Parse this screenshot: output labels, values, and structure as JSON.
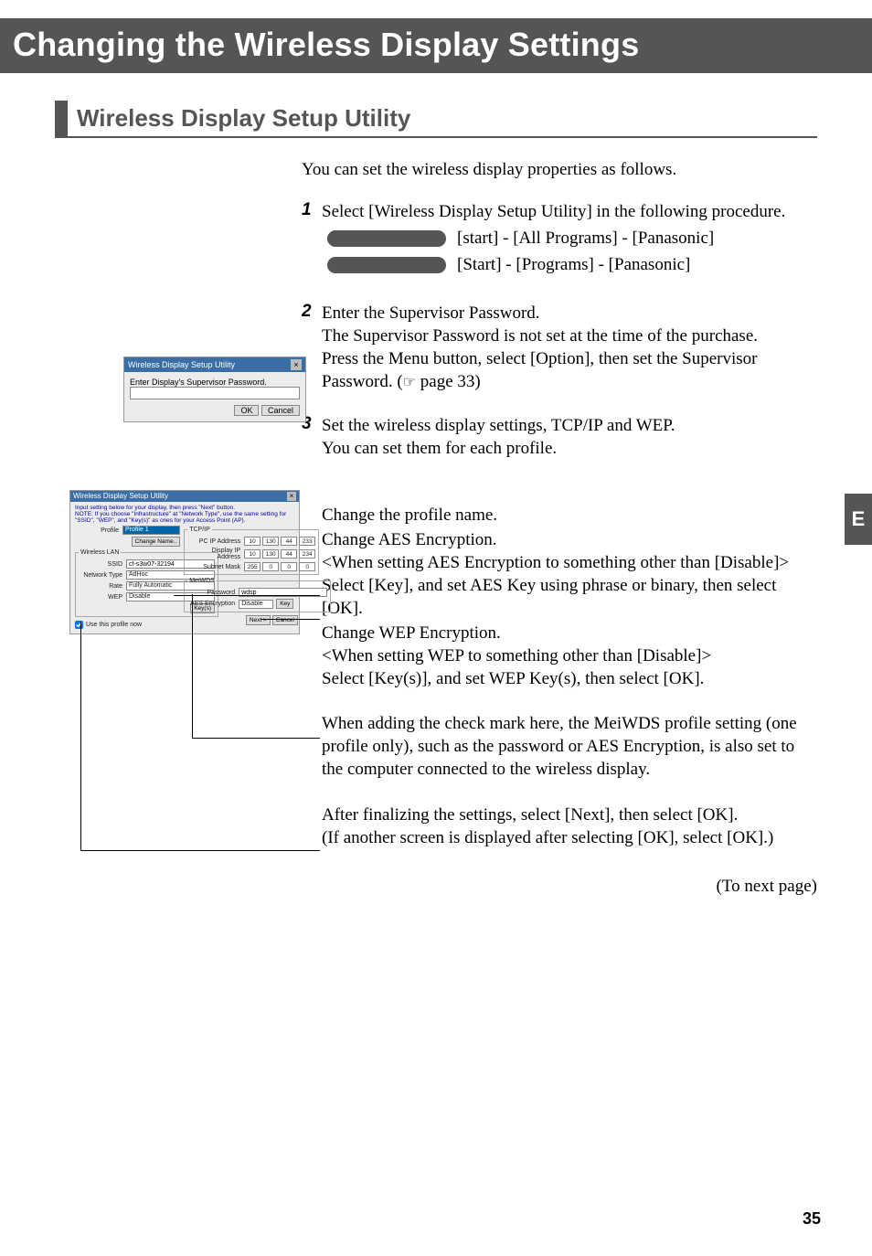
{
  "page": {
    "title": "Changing the Wireless Display Settings",
    "section_heading": "Wireless Display Setup Utility",
    "intro": "You can set the wireless display properties as follows.",
    "to_next": "(To next page)",
    "number": "35",
    "side_tab": "E"
  },
  "steps": {
    "s1": {
      "num": "1",
      "text": "Select [Wireless Display Setup Utility] in the following procedure.",
      "os1": "[start] - [All Programs] - [Panasonic]",
      "os2": "[Start] - [Programs] - [Panasonic]"
    },
    "s2": {
      "num": "2",
      "line1": "Enter the Supervisor Password.",
      "line2": "The Supervisor Password is not set at the time of the purchase.",
      "line3a": "Press the Menu button, select [Option], then set the Supervisor Password.  (",
      "line3c": " page 33)"
    },
    "s3": {
      "num": "3",
      "line1": "Set the wireless display settings, TCP/IP and WEP.",
      "line2": "You can set them for each profile."
    }
  },
  "callouts": {
    "c1": "Change the profile name.",
    "c2a": "Change AES Encryption.",
    "c2b": "<When setting AES Encryption to something other than [Disable]>",
    "c2c": "Select [Key], and set AES Key using phrase or binary, then select [OK].",
    "c3a": "Change WEP Encryption.",
    "c3b": "<When setting WEP to something other than [Disable]>",
    "c3c": "Select [Key(s)], and set WEP Key(s), then select [OK].",
    "c4": "When adding the check mark here, the MeiWDS profile setting (one profile only), such as the password or AES Encryption, is also set to the computer connected to the wireless display.",
    "c5": "After finalizing the settings, select [Next], then select [OK].",
    "c6": "(If another screen is displayed after selecting [OK], select [OK].)"
  },
  "dialog1": {
    "title": "Wireless Display Setup Utility",
    "prompt": "Enter Display's Supervisor Password.",
    "ok": "OK",
    "cancel": "Cancel"
  },
  "dialog2": {
    "title": "Wireless Display Setup Utility",
    "note1": "Input setting below for your display, then press \"Next\" button.",
    "note2": "NOTE: If you choose \"Infrastructure\" at \"Network Type\", use the same setting for \"SSID\", \"WEP\", and \"Key(s)\" as ones for your Access Point (AP).",
    "profile_label": "Profile",
    "profile_value": "Profile 1",
    "change_name": "Change Name..",
    "wlan_legend": "Wireless LAN",
    "ssid_label": "SSID",
    "ssid_value": "cf-s3w07-32194",
    "nettype_label": "Network Type",
    "nettype_value": "AdHoc",
    "rate_label": "Rate",
    "rate_value": "Fully Automatic",
    "wep_label": "WEP",
    "wep_value": "Disable",
    "keys_btn": "Key(s)",
    "tcpip_legend": "TCP/IP",
    "pcip_label": "PC IP Address",
    "dispip_label": "Display IP Address",
    "subnet_label": "Subnet Mask",
    "pcip": [
      "10",
      "130",
      "44",
      "233"
    ],
    "dispip": [
      "10",
      "130",
      "44",
      "234"
    ],
    "subnet": [
      "255",
      "0",
      "0",
      "0"
    ],
    "meiwds_legend": "MeiWDS",
    "pw_label": "Password",
    "pw_value": "wdsp",
    "aes_label": "AES Encryption",
    "aes_value": "Disable",
    "key_btn": "Key",
    "checkbox": "Use this profile now",
    "next": "Next >",
    "cancel": "Cancel"
  }
}
